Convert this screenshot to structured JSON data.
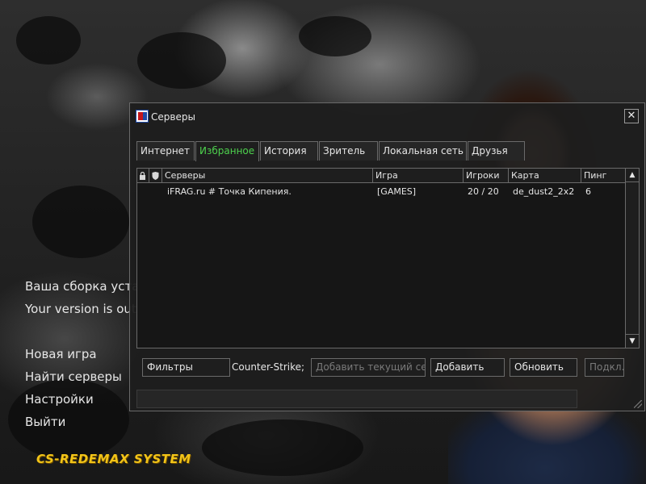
{
  "menu": {
    "version_ru": "Ваша сборка устарела",
    "version_en": "Your version is out of date",
    "items": [
      {
        "label": "Новая игра"
      },
      {
        "label": "Найти серверы"
      },
      {
        "label": "Настройки"
      },
      {
        "label": "Выйти"
      }
    ],
    "logo": "CS-REDEMAX SYSTEM"
  },
  "window": {
    "title": "Серверы",
    "icon": "counter-strike-icon",
    "close_label": "✕",
    "tabs": [
      {
        "label": "Интернет",
        "active": false
      },
      {
        "label": "Избранное",
        "active": true
      },
      {
        "label": "История",
        "active": false
      },
      {
        "label": "Зритель",
        "active": false
      },
      {
        "label": "Локальная сеть",
        "active": false
      },
      {
        "label": "Друзья",
        "active": false
      }
    ],
    "columns": {
      "lock": "lock-icon",
      "shield": "shield-icon",
      "servers": "Серверы",
      "game": "Игра",
      "players": "Игроки",
      "map": "Карта",
      "ping": "Пинг"
    },
    "rows": [
      {
        "server": "iFRAG.ru # Точка Кипения.",
        "game": "[GAMES]",
        "players": "20 / 20",
        "map": "de_dust2_2x2",
        "ping": "6"
      }
    ],
    "buttons": {
      "filters": "Фильтры",
      "game_label": "Counter-Strike;",
      "add_current": "Добавить текущий сер",
      "add": "Добавить",
      "refresh": "Обновить",
      "connect": "Подкл."
    }
  },
  "colors": {
    "active_tab": "#4dd14d",
    "logo": "#f2c418"
  }
}
